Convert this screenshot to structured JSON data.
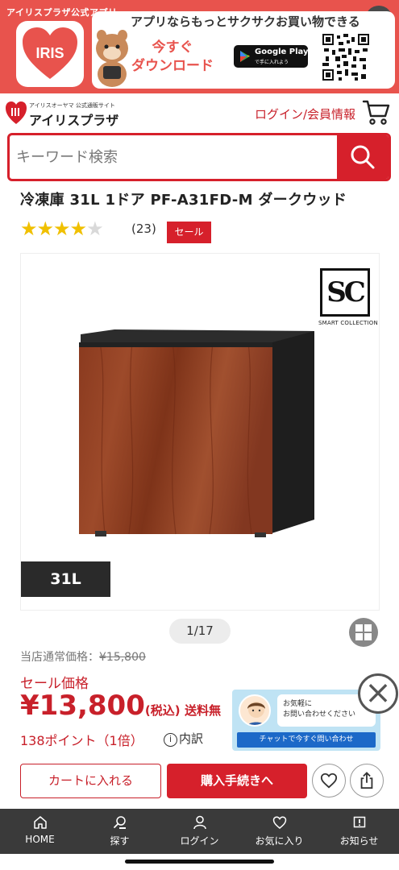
{
  "app_banner": {
    "tag": "アイリスプラザ公式アプリ",
    "logo_text": "IRIS",
    "message": "アプリならもっとサクサクお買い物できる",
    "cta_line1": "今すぐ",
    "cta_line2": "ダウンロード",
    "store_title": "Google Play",
    "store_sub": "で手に入れよう",
    "close_glyph": "×"
  },
  "header": {
    "logo_sub": "アイリスオーヤマ 公式通販サイト",
    "logo_name": "アイリスプラザ",
    "login_label": "ログイン/会員情報"
  },
  "search": {
    "placeholder": "キーワード検索"
  },
  "product": {
    "title": "冷凍庫 31L 1ドア PF-A31FD-M ダークウッド",
    "rating": 4,
    "rating_max": 5,
    "stars_on": "★★★★",
    "stars_off": "★",
    "review_count": "(23)",
    "sale_badge": "セール",
    "sc_logo": "SC",
    "sc_caption": "SMART COLLECTION",
    "capacity_label": "31L",
    "pager": "1/17"
  },
  "pricing": {
    "regular_label": "当店通常価格：",
    "regular_price": "¥15,800",
    "sale_label": "セール価格",
    "sale_price": "¥13,800",
    "tax_label": "(税込)",
    "shipping_label": "送料無",
    "points": "138ポイント（1倍）",
    "detail_icon": "i",
    "detail_label": "内訳"
  },
  "chat": {
    "line1": "お気軽に",
    "line2": "お問い合わせください",
    "button": "チャットで今すぐ問い合わせ",
    "close_glyph": "×"
  },
  "actions": {
    "add_to_cart": "カートに入れる",
    "checkout": "購入手続きへ"
  },
  "bottom_nav": [
    {
      "label": "HOME",
      "icon": "home-icon"
    },
    {
      "label": "探す",
      "icon": "search-icon"
    },
    {
      "label": "ログイン",
      "icon": "user-icon"
    },
    {
      "label": "お気に入り",
      "icon": "heart-icon"
    },
    {
      "label": "お知らせ",
      "icon": "notice-icon"
    }
  ],
  "colors": {
    "brand_red": "#d6202b",
    "banner_coral": "#e8534d",
    "star_yellow": "#f0c000",
    "nav_dark": "#3a3a3a",
    "chat_blue": "#1c69c8"
  }
}
